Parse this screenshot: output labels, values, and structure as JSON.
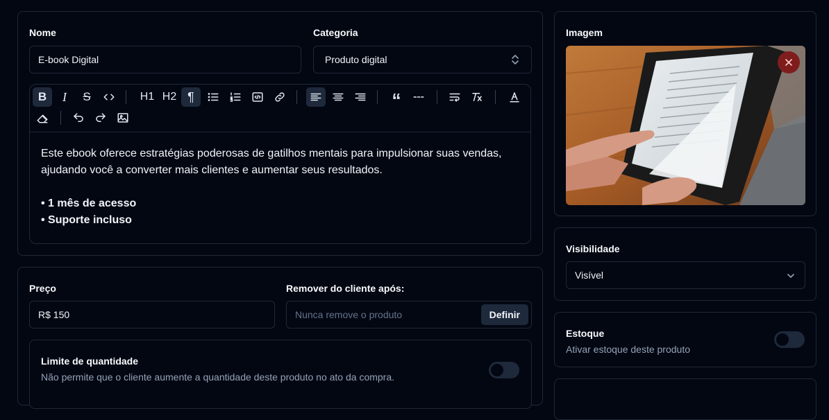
{
  "product": {
    "name_label": "Nome",
    "name_value": "E-book Digital",
    "category_label": "Categoria",
    "category_value": "Produto digital"
  },
  "editor": {
    "toolbar": [
      "bold",
      "italic",
      "strikethrough",
      "code",
      "heading-1",
      "heading-2",
      "paragraph",
      "bullet-list",
      "ordered-list",
      "code-block",
      "link",
      "align-left",
      "align-center",
      "align-right",
      "blockquote",
      "horizontal-rule",
      "hard-break",
      "clear-formatting",
      "text-color",
      "eraser",
      "undo",
      "redo",
      "image"
    ],
    "paragraph": "Este ebook oferece estratégias poderosas de gatilhos mentais para impulsionar suas vendas, ajudando você a converter mais clientes e aumentar seus resultados.",
    "bullets": [
      "1 mês de acesso",
      "Suporte incluso"
    ],
    "h1": "H1",
    "h2": "H2"
  },
  "pricing": {
    "price_label": "Preço",
    "price_value": "R$ 150",
    "remove_label": "Remover do cliente após:",
    "remove_placeholder": "Nunca remove o produto",
    "define_button": "Definir"
  },
  "quantity_limit": {
    "title": "Limite de quantidade",
    "description": "Não permite que o cliente aumente a quantidade deste produto no ato da compra.",
    "enabled": false
  },
  "image_panel": {
    "label": "Imagem",
    "remove_icon": "x-icon"
  },
  "visibility": {
    "label": "Visibilidade",
    "value": "Visível"
  },
  "stock": {
    "title": "Estoque",
    "description": "Ativar estoque deste produto",
    "enabled": false
  },
  "colors": {
    "background": "#030712",
    "border": "#1f2937",
    "remove_button": "#7f1d1d"
  }
}
